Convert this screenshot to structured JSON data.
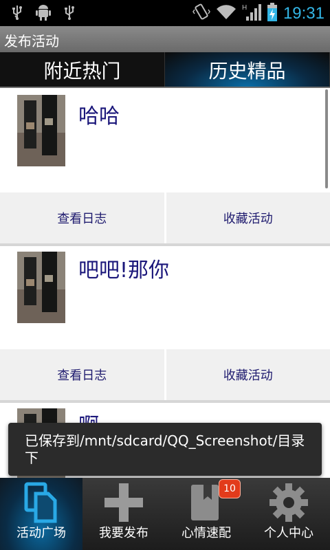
{
  "status_bar": {
    "left_icons": [
      "usb-icon",
      "android-debug-icon",
      "usb-icon"
    ],
    "right_icons": [
      "vibrate-icon",
      "wifi-icon",
      "signal-h-icon",
      "battery-charging-icon"
    ],
    "time": "19:31",
    "time_color": "#33b5e5"
  },
  "title_bar": {
    "title": "发布活动"
  },
  "tabs": [
    {
      "label": "附近热门",
      "active": false
    },
    {
      "label": "历史精品",
      "active": true
    }
  ],
  "list": {
    "items": [
      {
        "title": "哈哈",
        "actions": [
          "查看日志",
          "收藏活动"
        ]
      },
      {
        "title": "吧吧!那你",
        "actions": [
          "查看日志",
          "收藏活动"
        ]
      },
      {
        "title": "啊",
        "actions": []
      }
    ]
  },
  "toast": {
    "text": "已保存到/mnt/sdcard/QQ_Screenshot/目录下"
  },
  "bottom_nav": [
    {
      "label": "活动广场",
      "icon": "documents-icon",
      "active": true
    },
    {
      "label": "我要发布",
      "icon": "plus-icon",
      "active": false
    },
    {
      "label": "心情速配",
      "icon": "bookmark-book-icon",
      "active": false,
      "badge": "10"
    },
    {
      "label": "个人中心",
      "icon": "gear-icon",
      "active": false
    }
  ],
  "colors": {
    "accent_blue": "#33b5e5",
    "title_text": "#1a167a",
    "badge_red": "#e23b1b"
  }
}
